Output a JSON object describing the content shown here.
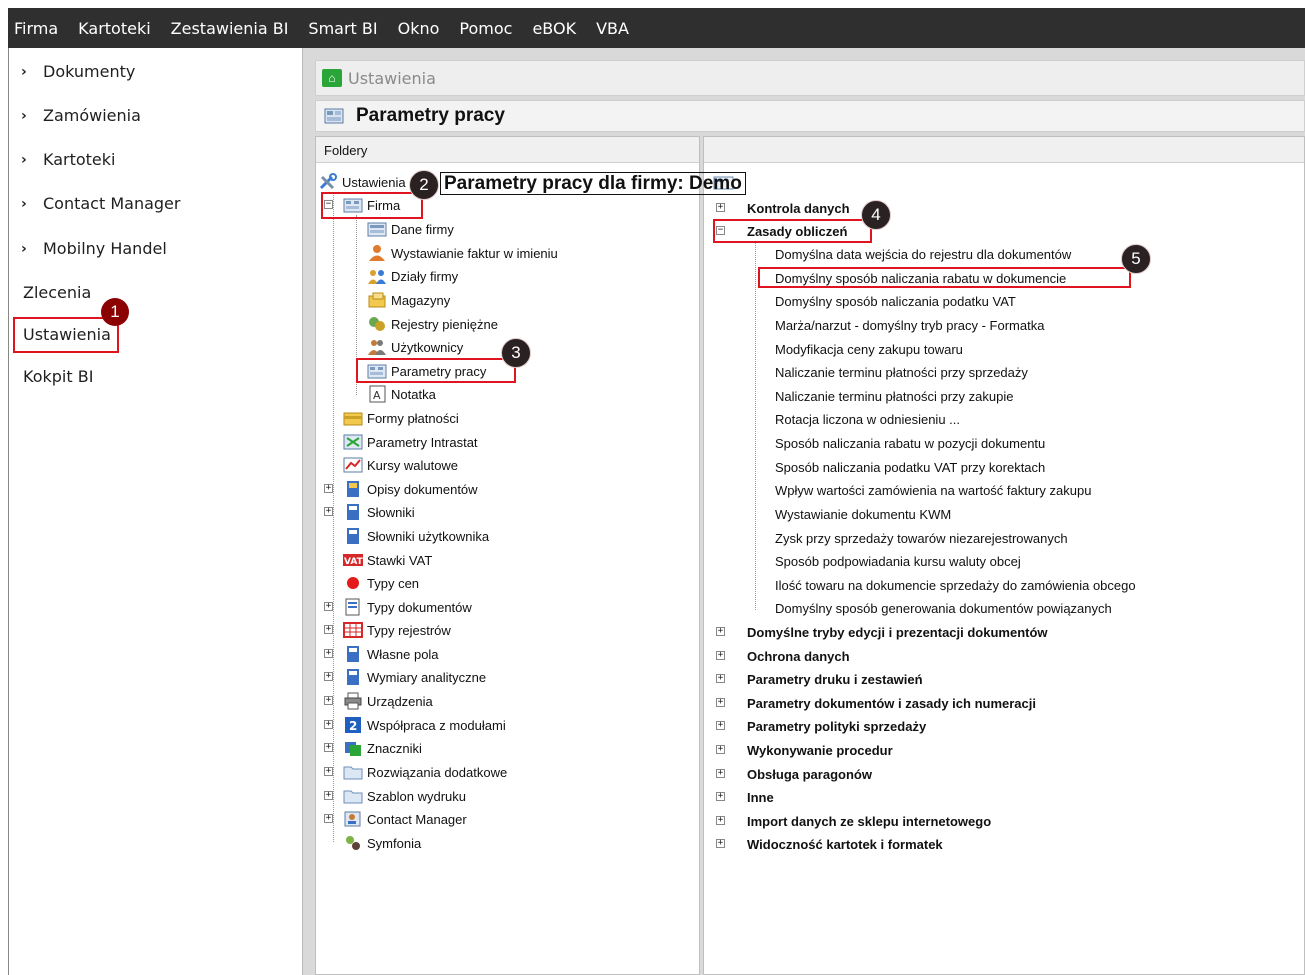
{
  "menubar": [
    "Firma",
    "Kartoteki",
    "Zestawienia BI",
    "Smart BI",
    "Okno",
    "Pomoc",
    "eBOK",
    "VBA"
  ],
  "leftnav": {
    "expandable": [
      "Dokumenty",
      "Zamówienia",
      "Kartoteki",
      "Contact Manager",
      "Mobilny Handel"
    ],
    "plain": [
      "Zlecenia",
      "Ustawienia",
      "Kokpit BI"
    ]
  },
  "window": {
    "title": "Ustawienia",
    "header": "Parametry pracy"
  },
  "folders": {
    "head": "Foldery",
    "root": "Ustawienia",
    "firma": "Firma",
    "firma_children": [
      "Dane firmy",
      "Wystawianie faktur w imieniu",
      "Działy firmy",
      "Magazyny",
      "Rejestry pieniężne",
      "Użytkownicy",
      "Parametry pracy",
      "Notatka"
    ],
    "others": [
      "Formy płatności",
      "Parametry Intrastat",
      "Kursy walutowe",
      "Opisy dokumentów",
      "Słowniki",
      "Słowniki użytkownika",
      "Stawki VAT",
      "Typy cen",
      "Typy dokumentów",
      "Typy rejestrów",
      "Własne pola",
      "Wymiary analityczne",
      "Urządzenia",
      "Współpraca z modułami",
      "Znaczniki",
      "Rozwiązania dodatkowe",
      "Szablon wydruku",
      "Contact Manager",
      "Symfonia"
    ]
  },
  "params": {
    "title": "Parametry pracy dla firmy: Demo",
    "kontrola": "Kontrola danych",
    "zasady": "Zasady obliczeń",
    "zasady_children": [
      "Domyślna data wejścia do rejestru dla dokumentów",
      "Domyślny sposób naliczania rabatu w dokumencie",
      "Domyślny sposób naliczania podatku VAT",
      "Marża/narzut - domyślny tryb pracy - Formatka",
      "Modyfikacja ceny zakupu towaru",
      "Naliczanie terminu płatności przy sprzedaży",
      "Naliczanie terminu płatności przy zakupie",
      "Rotacja liczona w odniesieniu ...",
      "Sposób naliczania rabatu w pozycji dokumentu",
      "Sposób naliczania podatku VAT przy korektach",
      "Wpływ wartości zamówienia na wartość faktury zakupu",
      "Wystawianie dokumentu KWM",
      "Zysk przy sprzedaży towarów niezarejestrowanych",
      "Sposób podpowiadania kursu waluty obcej",
      "Ilość towaru na dokumencie sprzedaży do zamówienia obcego",
      "Domyślny sposób generowania dokumentów powiązanych"
    ],
    "groups": [
      "Domyślne tryby edycji i prezentacji dokumentów",
      "Ochrona danych",
      "Parametry druku i zestawień",
      "Parametry dokumentów i zasady ich numeracji",
      "Parametry polityki sprzedaży",
      "Wykonywanie procedur",
      "Obsługa paragonów",
      "Inne",
      "Import danych ze sklepu internetowego",
      "Widoczność kartotek i formatek"
    ]
  },
  "badges": [
    "1",
    "2",
    "3",
    "4",
    "5"
  ],
  "colors": {
    "menubar": "#2f2f2f",
    "highlight": "#e0141e",
    "badge": "#2a2222"
  }
}
